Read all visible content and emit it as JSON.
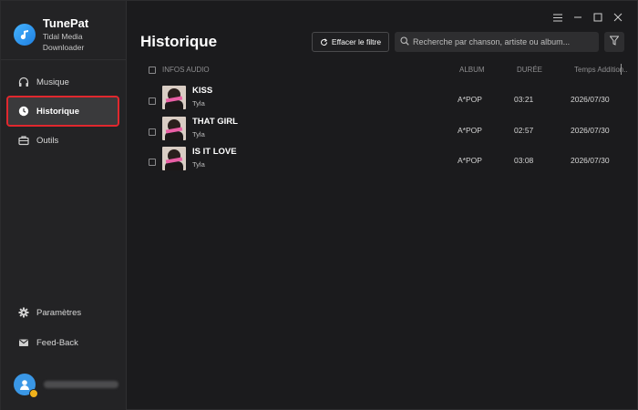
{
  "app": {
    "name": "TunePat",
    "subtitle": "Tidal Media Downloader"
  },
  "sidebar": {
    "items": [
      {
        "label": "Musique",
        "icon": "headphones-icon"
      },
      {
        "label": "Historique",
        "icon": "clock-icon",
        "active": true
      },
      {
        "label": "Outils",
        "icon": "toolbox-icon"
      }
    ],
    "bottom": [
      {
        "label": "Paramètres",
        "icon": "gear-icon"
      },
      {
        "label": "Feed-Back",
        "icon": "mail-icon"
      }
    ]
  },
  "header": {
    "title": "Historique",
    "clear_filter_label": "Effacer le filtre",
    "search_placeholder": "Recherche par chanson, artiste ou album..."
  },
  "table": {
    "columns": [
      "INFOS AUDIO",
      "ALBUM",
      "DURÉE",
      "Temps Addition..."
    ],
    "rows": [
      {
        "title": "KISS",
        "artist": "Tyla",
        "album": "A*POP",
        "duration": "03:21",
        "date": "2026/07/30"
      },
      {
        "title": "THAT GIRL",
        "artist": "Tyla",
        "album": "A*POP",
        "duration": "02:57",
        "date": "2026/07/30"
      },
      {
        "title": "IS IT LOVE",
        "artist": "Tyla",
        "album": "A*POP",
        "duration": "03:08",
        "date": "2026/07/30"
      }
    ]
  },
  "colors": {
    "background": "#1b1b1d",
    "sidebar": "#232325",
    "active_highlight": "#e0282e",
    "logo": "#2f95f0",
    "avatar": "#3a97e6",
    "badge": "#f1b21b"
  }
}
